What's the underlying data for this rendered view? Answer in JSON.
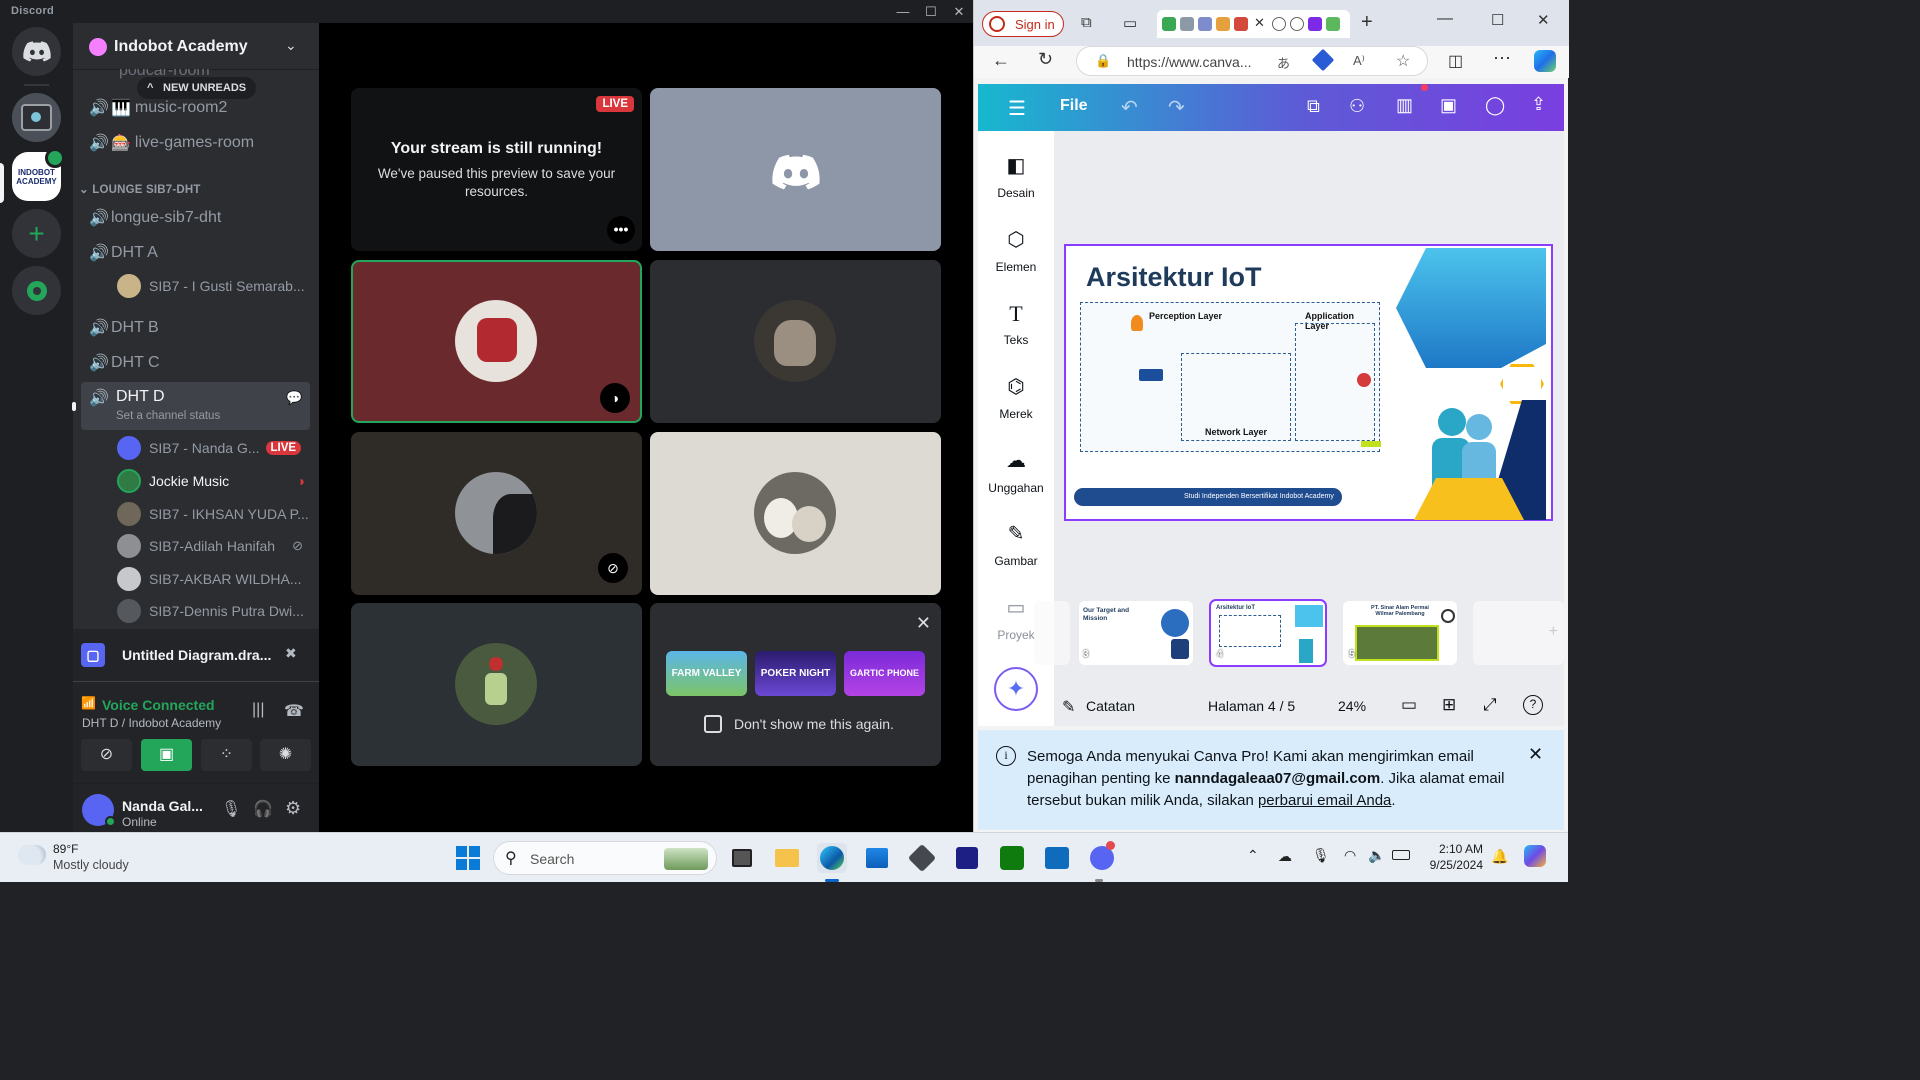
{
  "discord": {
    "window_title": "Discord",
    "server_name": "Indobot Academy",
    "new_unreads": "NEW UNREADS",
    "partial_channel": "podcar-room",
    "channels_top": [
      {
        "name": "music-room2",
        "emoji": "🎹"
      },
      {
        "name": "live-games-room",
        "emoji": "🎰"
      }
    ],
    "category": "LOUNGE SIB7-DHT",
    "lounge_channels": [
      {
        "name": "longue-sib7-dht"
      },
      {
        "name": "DHT A",
        "users": [
          "SIB7 - I Gusti Semarab..."
        ]
      },
      {
        "name": "DHT B"
      },
      {
        "name": "DHT C"
      }
    ],
    "active_channel": {
      "name": "DHT D",
      "status": "Set a channel status",
      "users": [
        {
          "name": "SIB7 - Nanda G...",
          "badge": "LIVE"
        },
        {
          "name": "Jockie Music"
        },
        {
          "name": "SIB7 - IKHSAN YUDA P..."
        },
        {
          "name": "SIB7-Adilah Hanifah"
        },
        {
          "name": "SIB7-AKBAR WILDHA..."
        },
        {
          "name": "SIB7-Dennis Putra Dwi..."
        }
      ]
    },
    "activity": {
      "name": "Untitled Diagram.dra..."
    },
    "voice": {
      "status": "Voice Connected",
      "location": "DHT D / Indobot Academy"
    },
    "user": {
      "name": "Nanda Gal...",
      "status": "Online"
    },
    "stream": {
      "badge": "LIVE",
      "heading": "Your stream is still running!",
      "body": "We've paused this preview to save your resources."
    },
    "activities_popup": {
      "checkbox_label": "Don't show me this again.",
      "games": [
        "FARM VALLEY",
        "POKER NIGHT",
        "GARTIC PHONE"
      ]
    }
  },
  "browser": {
    "signin": "Sign in",
    "url": "https://www.canva...",
    "canva": {
      "file_menu": "File",
      "sidebar": [
        "Desain",
        "Elemen",
        "Teks",
        "Merek",
        "Unggahan",
        "Gambar",
        "Proyek"
      ],
      "slide": {
        "title": "Arsitektur IoT",
        "perception": "Perception Layer",
        "application": "Application Layer",
        "network": "Network Layer",
        "footer": "Studi Independen Bersertifikat Indobot Academy"
      },
      "thumbnails": [
        {
          "num": "3",
          "label": "Our Target and Mission"
        },
        {
          "num": "4",
          "label": "Arsitektur IoT"
        },
        {
          "num": "5",
          "label": "PT. Sinar Alam Permai Wilmar Palembang"
        }
      ],
      "notes": "Catatan",
      "page": "Halaman 4 / 5",
      "zoom": "24%"
    },
    "notice": {
      "part1": "Semoga Anda menyukai Canva Pro! Kami akan mengirimkan email penagihan penting ke ",
      "email": "nanndagaleaa07@gmail.com",
      "part2": ". Jika alamat email tersebut bukan milik Anda, silakan ",
      "link": "perbarui email Anda",
      "part3": "."
    }
  },
  "taskbar": {
    "weather_temp": "89°F",
    "weather_desc": "Mostly cloudy",
    "search": "Search",
    "time": "2:10 AM",
    "date": "9/25/2024"
  },
  "colors": {
    "discord_green": "#23a55a",
    "live_red": "#da373c",
    "canva_purple": "#7d2ae8"
  }
}
